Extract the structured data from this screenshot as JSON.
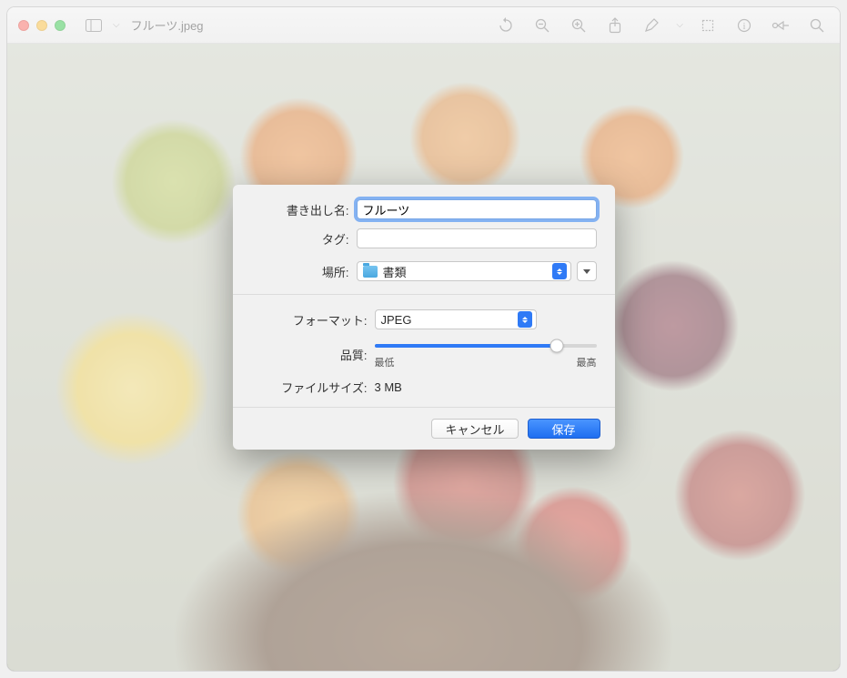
{
  "window": {
    "title": "フルーツ.jpeg"
  },
  "toolbar_icons": {
    "sidebar": "sidebar-icon",
    "rotate": "rotate-icon",
    "zoom_out": "zoom-out-icon",
    "zoom_in": "zoom-in-icon",
    "share": "share-icon",
    "markup": "markup-icon",
    "crop": "crop-icon",
    "info": "info-icon",
    "edit": "edit-icon",
    "search": "search-icon"
  },
  "sheet": {
    "export_name_label": "書き出し名:",
    "export_name_value": "フルーツ",
    "tags_label": "タグ:",
    "tags_value": "",
    "location_label": "場所:",
    "location_value": "書類",
    "format_label": "フォーマット:",
    "format_value": "JPEG",
    "quality_label": "品質:",
    "quality_min_label": "最低",
    "quality_max_label": "最高",
    "quality_percent": 82,
    "filesize_label": "ファイルサイズ:",
    "filesize_value": "3 MB",
    "cancel_label": "キャンセル",
    "save_label": "保存"
  }
}
